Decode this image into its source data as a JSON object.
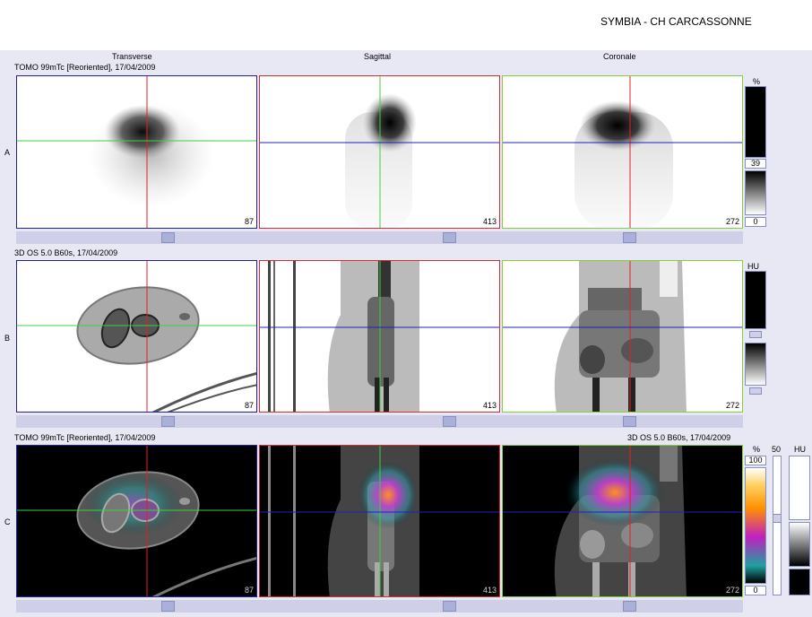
{
  "header": {
    "site": "SYMBIA - CH CARCASSONNE"
  },
  "columns": {
    "transverse": "Transverse",
    "sagittal": "Sagittal",
    "coronal": "Coronale"
  },
  "rows": {
    "a": {
      "label": "A",
      "series": "TOMO 99mTc [Reoriented], 17/04/2009"
    },
    "b": {
      "label": "B",
      "series": "3D  OS  5.0  B60s, 17/04/2009"
    },
    "c": {
      "label": "C",
      "series_left": "TOMO 99mTc [Reoriented], 17/04/2009",
      "series_right": "3D  OS  5.0  B60s, 17/04/2009"
    }
  },
  "slices": {
    "transverse": "87",
    "sagittal": "413",
    "coronal": "272"
  },
  "scale_a": {
    "unit": "%",
    "upper": "39",
    "lower": "0"
  },
  "scale_b": {
    "unit": "HU"
  },
  "scale_c": {
    "unit": "%",
    "upper": "100",
    "lower": "0",
    "blend": "50",
    "unit2": "HU"
  },
  "colors": {
    "crosshair_red": "#e02020",
    "crosshair_green": "#40d040",
    "crosshair_blue": "#2020c0",
    "panel_bg": "#e8e8f4"
  }
}
